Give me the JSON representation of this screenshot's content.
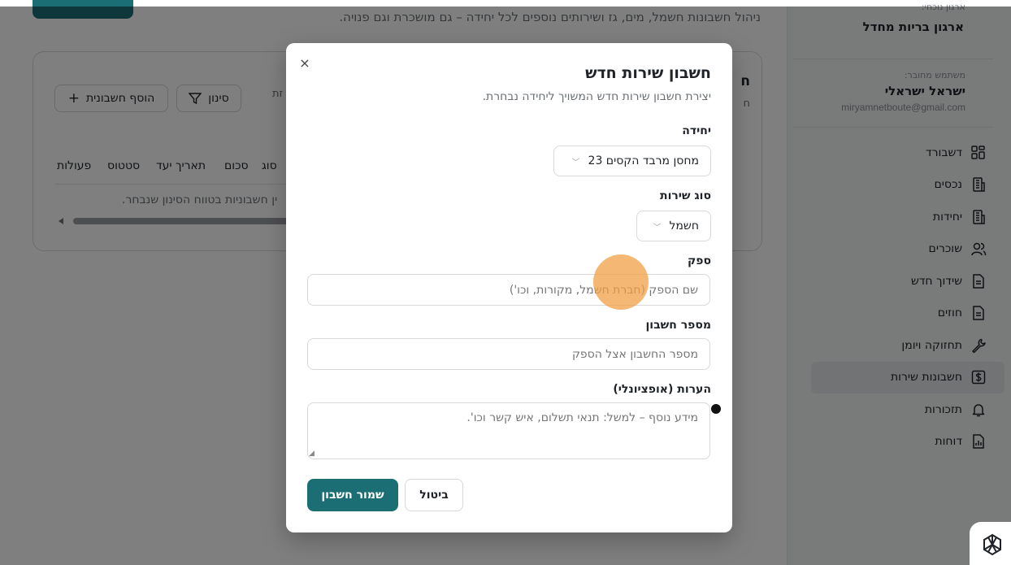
{
  "sidebar": {
    "org_label": "ארגון נוכחי:",
    "org_name": "ארגון בריות מחדל",
    "user_label": "משתמש מחובר:",
    "user_name": "ישראל ישראלי",
    "user_email": "miryamnetboute@gmail.com",
    "items": [
      {
        "label": "דשבורד",
        "icon": "dashboard-icon"
      },
      {
        "label": "נכסים",
        "icon": "building-icon"
      },
      {
        "label": "יחידות",
        "icon": "building-icon"
      },
      {
        "label": "שוכרים",
        "icon": "users-icon"
      },
      {
        "label": "שידוך חדש",
        "icon": "document-icon"
      },
      {
        "label": "חוזים",
        "icon": "document-icon"
      },
      {
        "label": "תחזוקה ויומן",
        "icon": "wrench-icon"
      },
      {
        "label": "חשבונות שירות",
        "icon": "dollar-icon",
        "active": true
      },
      {
        "label": "תזכורות",
        "icon": "bell-icon"
      },
      {
        "label": "דוחות",
        "icon": "report-icon"
      }
    ]
  },
  "main": {
    "description": "ניהול חשבונות חשמל, מים, גז ושירותים נוספים לכל יחידה – גם מושכרת וגם פנויה.",
    "add_button": "הוסף חשבונית",
    "filter_button": "סינון",
    "table_headers": [
      "סוג",
      "סכום",
      "תאריך יעד",
      "סטטוס",
      "פעולות"
    ],
    "empty_text": "ין חשבוניות בטווח הסינון שנבחר.",
    "partial_card_title": "ח",
    "partial_card_sub": "ח",
    "partial_text": "זת"
  },
  "modal": {
    "title": "חשבון שירות חדש",
    "subtitle": "יצירת חשבון שירות חדש המשויך ליחידה נבחרת.",
    "close": "×",
    "unit_label": "יחידה",
    "unit_value": "מחסן מרבד הקסים 23",
    "service_label": "סוג שירות",
    "service_value": "חשמל",
    "provider_label": "ספק",
    "provider_placeholder": "שם הספק (חברת חשמל, מקורות, וכו')",
    "account_label": "מספר חשבון",
    "account_placeholder": "מספר החשבון אצל הספק",
    "notes_label": "הערות (אופציונלי)",
    "notes_placeholder": "מידע נוסף – למשל: תנאי תשלום, איש קשר וכו'.",
    "save_button": "שמור חשבון",
    "cancel_button": "ביטול"
  },
  "colors": {
    "accent": "#1b6f74",
    "overlay": "rgba(0,0,0,0.5)"
  }
}
